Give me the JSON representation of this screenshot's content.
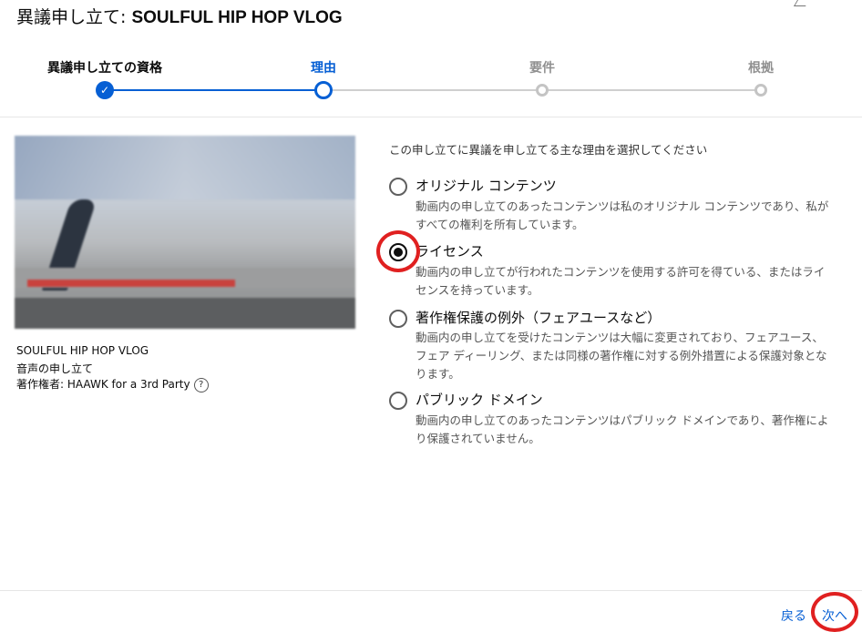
{
  "dialog": {
    "title_prefix": "異議申し立て: ",
    "title_video": "SOULFUL HIP HOP VLOG"
  },
  "stepper": {
    "steps": [
      {
        "label": "異議申し立ての資格",
        "state": "done"
      },
      {
        "label": "理由",
        "state": "active"
      },
      {
        "label": "要件",
        "state": "pending"
      },
      {
        "label": "根拠",
        "state": "pending"
      }
    ],
    "check_glyph": "✓"
  },
  "video": {
    "title": "SOULFUL HIP HOP VLOG",
    "claim_type": "音声の申し立て",
    "owner": "著作権者: HAAWK for a 3rd Party",
    "help_glyph": "?"
  },
  "reason": {
    "prompt": "この申し立てに異議を申し立てる主な理由を選択してください",
    "options": [
      {
        "title": "オリジナル コンテンツ",
        "desc": "動画内の申し立てのあったコンテンツは私のオリジナル コンテンツであり、私がすべての権利を所有しています。",
        "checked": false
      },
      {
        "title": "ライセンス",
        "desc": "動画内の申し立てが行われたコンテンツを使用する許可を得ている、またはライセンスを持っています。",
        "checked": true
      },
      {
        "title": "著作権保護の例外（フェアユースなど）",
        "desc": "動画内の申し立てを受けたコンテンツは大幅に変更されており、フェアユース、フェア ディーリング、または同様の著作権に対する例外措置による保護対象となります。",
        "checked": false
      },
      {
        "title": "パブリック ドメイン",
        "desc": "動画内の申し立てのあったコンテンツはパブリック ドメインであり、著作権により保護されていません。",
        "checked": false
      }
    ]
  },
  "footer": {
    "back_label": "戻る",
    "next_label": "次へ"
  },
  "colors": {
    "accent": "#065fd4",
    "annotation": "#e02020",
    "pending": "#c4c4c4"
  }
}
